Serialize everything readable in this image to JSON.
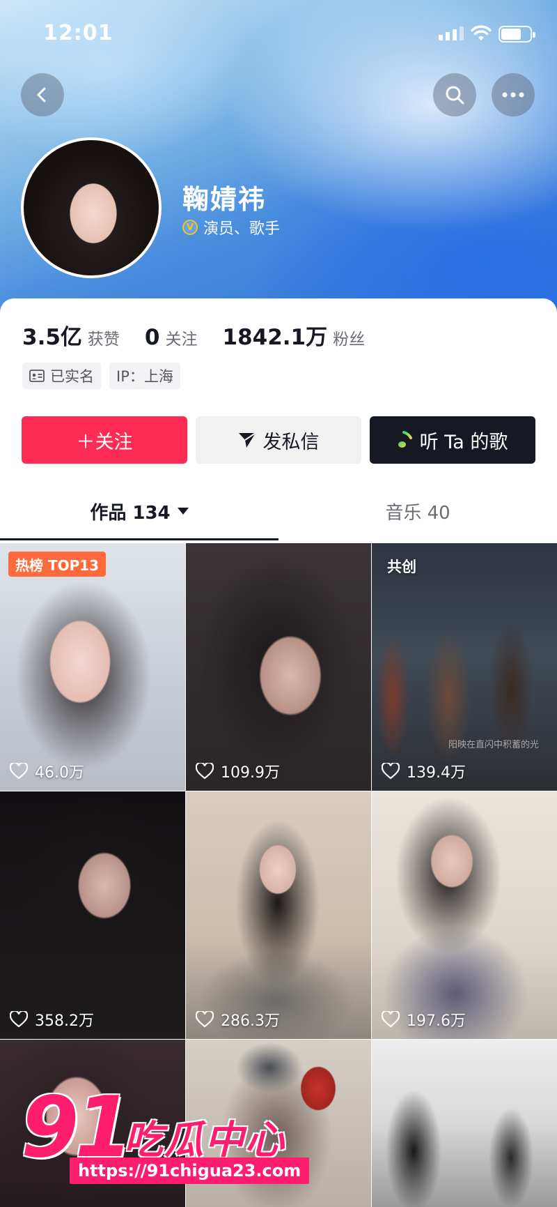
{
  "status_bar": {
    "time": "12:01"
  },
  "profile": {
    "name": "鞠婧祎",
    "verify_badge": "V",
    "verify_text": "演员、歌手",
    "stats": [
      {
        "value": "3.5亿",
        "label": "获赞"
      },
      {
        "value": "0",
        "label": "关注"
      },
      {
        "value": "1842.1万",
        "label": "粉丝"
      }
    ],
    "tags": [
      {
        "icon": "id-card-icon",
        "label": "已实名"
      },
      {
        "label": "IP：上海"
      }
    ]
  },
  "actions": {
    "follow": "＋关注",
    "message": "发私信",
    "song": "听 Ta 的歌"
  },
  "tabs": {
    "works": "作品 134",
    "music": "音乐 40"
  },
  "videos": [
    {
      "likes": "46.0万",
      "badge": "热榜 TOP13"
    },
    {
      "likes": "109.9万"
    },
    {
      "likes": "139.4万",
      "badge": "共创",
      "caption": "阳映在直闪中积蓄的光"
    },
    {
      "likes": "358.2万"
    },
    {
      "likes": "286.3万"
    },
    {
      "likes": "197.6万"
    },
    {},
    {},
    {}
  ],
  "watermark": {
    "logo": "91",
    "name": "吃瓜中心",
    "url": "https://91chigua23.com"
  },
  "colors": {
    "follow": "#fe2c55",
    "dark_button": "#161823",
    "hot_badge": "#ff6a3d",
    "watermark": "#ff1e6e"
  }
}
